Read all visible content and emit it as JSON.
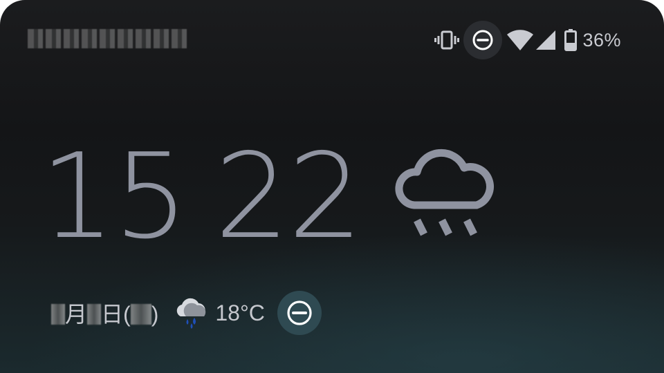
{
  "status_bar": {
    "carrier_label": "",
    "icons": [
      "vibrate-icon",
      "do-not-disturb-icon",
      "wifi-icon",
      "cell-signal-icon",
      "battery-icon"
    ],
    "battery_percent": "36%"
  },
  "clock": {
    "hour": "15",
    "minute": "22",
    "weather_icon": "rain-cloud-icon"
  },
  "info": {
    "month_suffix": "月",
    "day_suffix": "日(",
    "weekday_close": ")",
    "weather_icon": "rain-cloud-colored-icon",
    "temperature": "18°C",
    "dnd_icon": "do-not-disturb-icon"
  },
  "colors": {
    "clock": "#8f93a0",
    "text": "#c6c8ce",
    "dnd_status_bg": "#2b2d31",
    "dnd_info_bg": "#2f4a52",
    "rain_drops": "#1f4fb8"
  }
}
